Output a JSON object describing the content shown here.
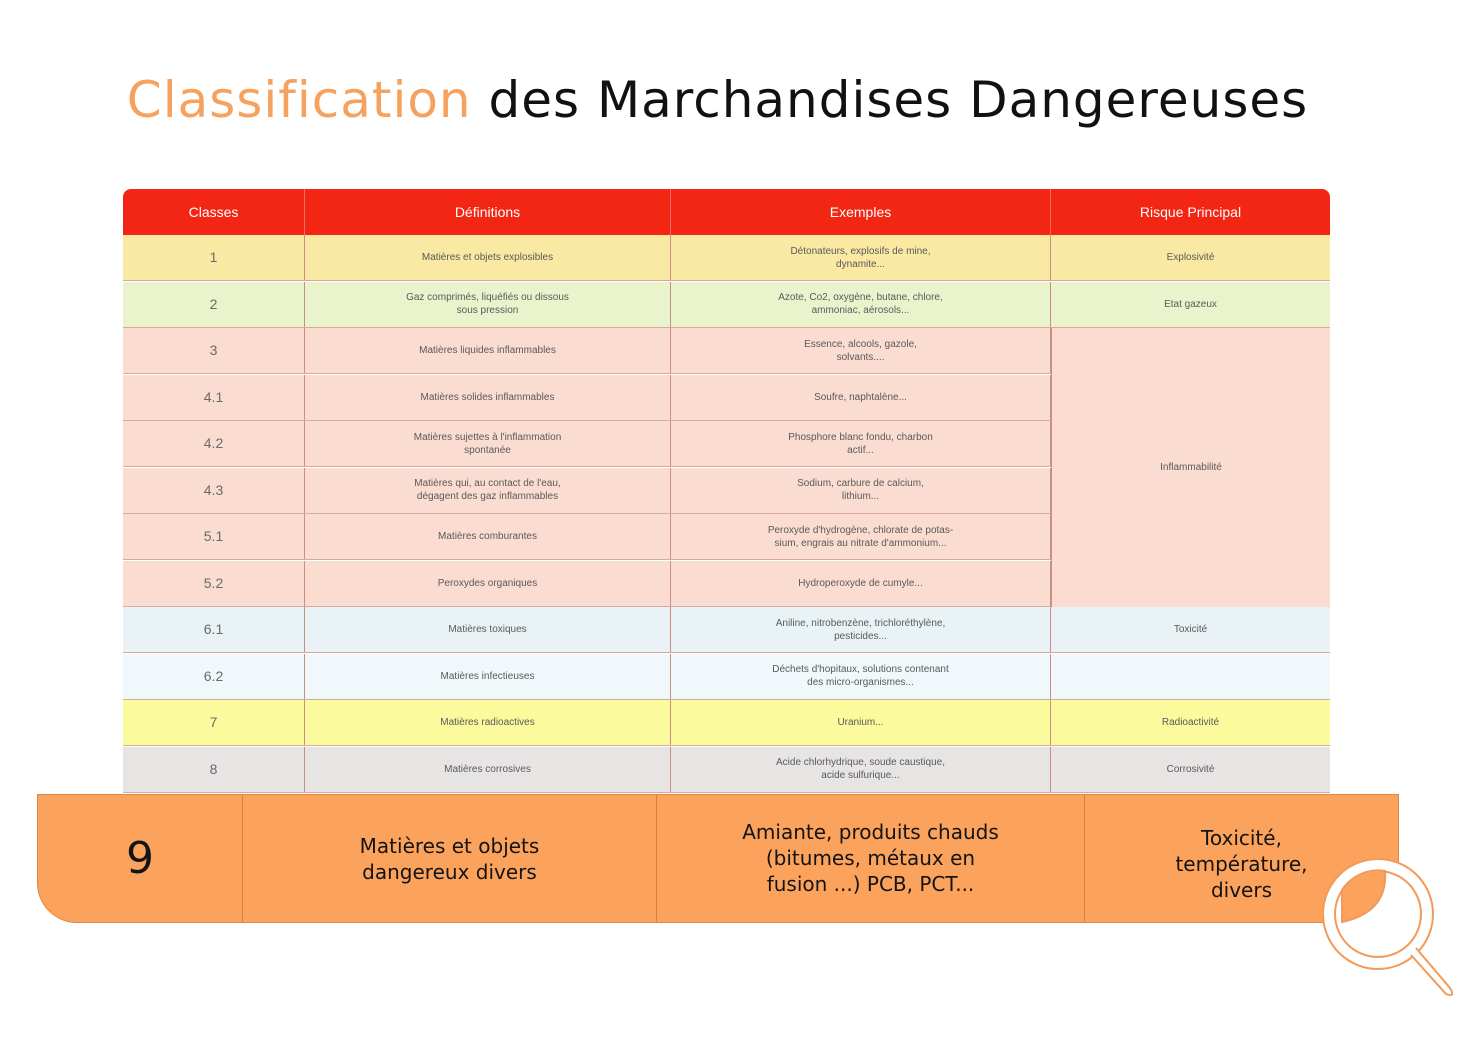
{
  "title": {
    "accent": "Classification",
    "rest": " des Marchandises Dangereuses"
  },
  "colors": {
    "header": "#f22613",
    "accent": "#f6a25e",
    "class9": "#fba35d"
  },
  "table": {
    "headers": [
      "Classes",
      "Définitions",
      "Exemples",
      "Risque Principal"
    ],
    "rows": [
      {
        "classe": "1",
        "definition": "Matières et objets explosibles",
        "exemples": "Détonateurs, explosifs de mine,\ndynamite...",
        "risque": "Explosivité"
      },
      {
        "classe": "2",
        "definition": "Gaz comprimés, liquéfiés ou dissous\nsous pression",
        "exemples": "Azote, Co2, oxygène, butane, chlore,\nammoniac, aérosols...",
        "risque": "Etat gazeux"
      },
      {
        "classe": "3",
        "definition": "Matières liquides inflammables",
        "exemples": "Essence, alcools, gazole,\nsolvants....",
        "risque": ""
      },
      {
        "classe": "4.1",
        "definition": "Matières solides inflammables",
        "exemples": "Soufre, naphtalène...",
        "risque": ""
      },
      {
        "classe": "4.2",
        "definition": "Matières sujettes à l'inflammation\nspontanée",
        "exemples": "Phosphore blanc fondu, charbon\nactif...",
        "risque": ""
      },
      {
        "classe": "4.3",
        "definition": "Matières qui, au contact de l'eau,\ndégagent des gaz inflammables",
        "exemples": "Sodium, carbure de calcium,\nlithium...",
        "risque": ""
      },
      {
        "classe": "5.1",
        "definition": "Matières comburantes",
        "exemples": "Peroxyde d'hydrogène, chlorate de potas-\nsium, engrais au nitrate d'ammonium...",
        "risque": ""
      },
      {
        "classe": "5.2",
        "definition": "Peroxydes organiques",
        "exemples": "Hydroperoxyde de cumyle...",
        "risque": ""
      },
      {
        "classe": "6.1",
        "definition": "Matières toxiques",
        "exemples": "Aniline, nitrobenzène, trichloréthylène,\npesticides...",
        "risque": "Toxicité"
      },
      {
        "classe": "6.2",
        "definition": "Matières infectieuses",
        "exemples": "Déchets d'hopitaux, solutions contenant\ndes micro-organismes...",
        "risque": ""
      },
      {
        "classe": "7",
        "definition": "Matières radioactives",
        "exemples": "Uranium...",
        "risque": "Radioactivité"
      },
      {
        "classe": "8",
        "definition": "Matières corrosives",
        "exemples": "Acide chlorhydrique, soude caustique,\nacide sulfurique...",
        "risque": "Corrosivité"
      }
    ],
    "merged_risque": "Inflammabilité",
    "row_colors": [
      "#f9e9a2",
      "#e9f4cc",
      "#fadcd0",
      "#fadcd0",
      "#fadcd0",
      "#fadcd0",
      "#fadcd0",
      "#fadcd0",
      "#e9f2f5",
      "#f1f8fb",
      "#fbfa9d",
      "#e7e4e4"
    ]
  },
  "class9": {
    "classe": "9",
    "definition": "Matières et objets\ndangereux divers",
    "exemples": "Amiante, produits chauds\n(bitumes, métaux en\nfusion ...) PCB, PCT...",
    "risque": "Toxicité,\ntempérature,\ndivers"
  },
  "icons": {
    "magnifier": "magnifier-icon"
  }
}
